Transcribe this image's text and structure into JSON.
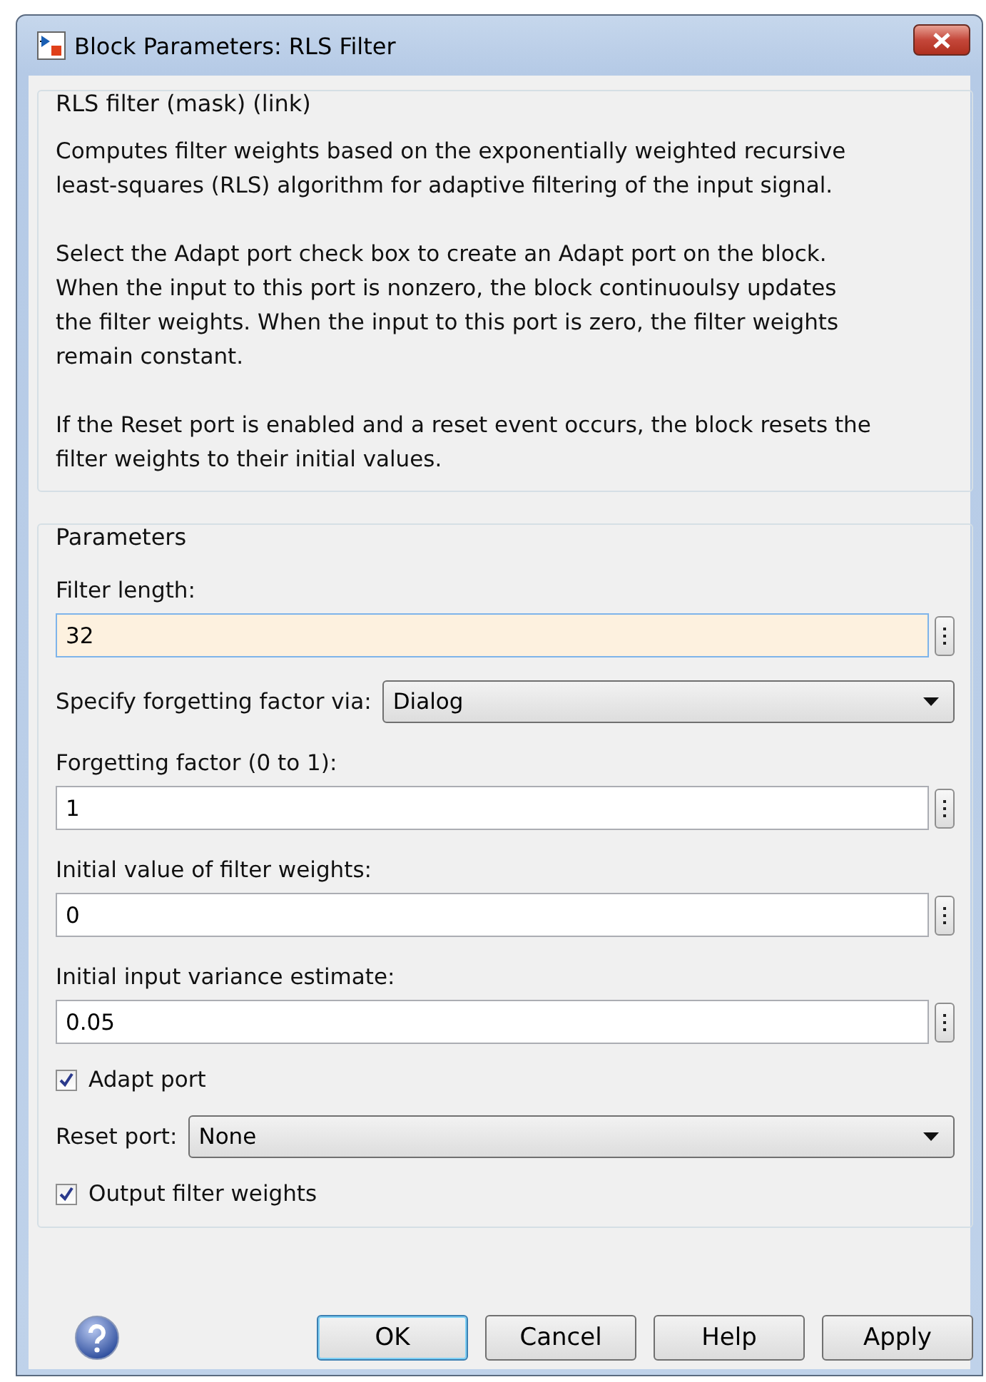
{
  "window": {
    "title": "Block Parameters: RLS Filter"
  },
  "description": {
    "title": "RLS filter (mask) (link)",
    "paragraphs": [
      "Computes filter weights based on the exponentially weighted recursive\nleast-squares (RLS) algorithm for adaptive filtering of the input signal.",
      "Select the Adapt port check box to create an Adapt port on the block.\nWhen the input to this port is nonzero, the block continuoulsy updates\nthe filter weights. When the input to this port is zero, the filter weights\nremain constant.",
      "If the Reset port is enabled and a reset event occurs, the block resets the\nfilter weights to their initial values."
    ]
  },
  "parameters": {
    "title": "Parameters",
    "fields": [
      {
        "kind": "text",
        "label": "Filter length:",
        "value": "32",
        "focused": true
      },
      {
        "kind": "select",
        "label": "Specify forgetting factor via:",
        "value": "Dialog"
      },
      {
        "kind": "text",
        "label": "Forgetting factor (0 to 1):",
        "value": "1",
        "focused": false
      },
      {
        "kind": "text",
        "label": "Initial value of filter weights:",
        "value": "0",
        "focused": false
      },
      {
        "kind": "text",
        "label": "Initial input variance estimate:",
        "value": "0.05",
        "focused": false
      },
      {
        "kind": "checkbox",
        "label": "Adapt port",
        "checked": true
      },
      {
        "kind": "select",
        "label": "Reset port:",
        "value": "None"
      },
      {
        "kind": "checkbox",
        "label": "Output filter weights",
        "checked": true
      }
    ]
  },
  "buttons": [
    {
      "label": "OK",
      "default": true
    },
    {
      "label": "Cancel",
      "default": false
    },
    {
      "label": "Help",
      "default": false
    },
    {
      "label": "Apply",
      "default": false
    }
  ]
}
